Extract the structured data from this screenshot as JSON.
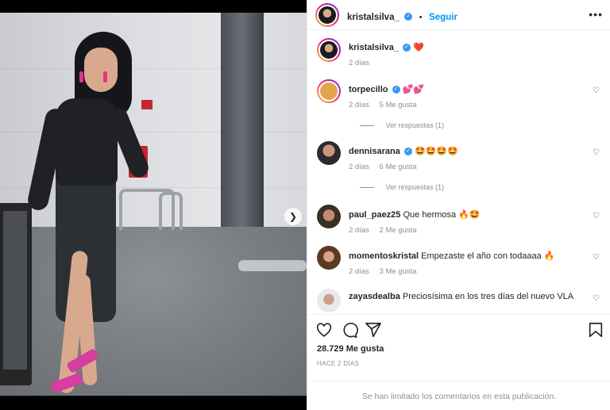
{
  "post": {
    "author": "kristalsilva_",
    "follow_label": "Seguir",
    "more_label": "•••"
  },
  "caption": {
    "username": "kristalsilva_",
    "text": "❤️",
    "time": "2 días"
  },
  "comments": [
    {
      "username": "torpecillo",
      "text": "💕💕",
      "time": "2 días",
      "likes": "5 Me gusta",
      "replies": "Ver respuestas (1)"
    },
    {
      "username": "dennisarana",
      "text": "🤩🤩🤩🤩",
      "time": "2 días",
      "likes": "6 Me gusta",
      "replies": "Ver respuestas (1)"
    },
    {
      "username": "paul_paez25",
      "text": "Que hermosa 🔥🤩",
      "time": "2 días",
      "likes": "2 Me gusta",
      "replies": ""
    },
    {
      "username": "momentoskristal",
      "text": "Empezaste el año con todaaaa 🔥",
      "time": "2 días",
      "likes": "3 Me gusta",
      "replies": ""
    },
    {
      "username": "zayasdealba",
      "text": "Preciosísima en los tres días del nuevo VLA",
      "time": "",
      "likes": "",
      "replies": ""
    }
  ],
  "stats": {
    "likes": "28.729 Me gusta",
    "posted": "HACE 2 DÍAS"
  },
  "footer": {
    "notice": "Se han limitado los comentarios en esta publicación."
  },
  "icons": {
    "heart": "heart-icon",
    "comment": "comment-icon",
    "share": "share-icon",
    "save": "bookmark-icon",
    "verified": "verified-badge-icon",
    "next": "chevron-right-icon"
  },
  "colors": {
    "accent": "#0095f6",
    "verified": "#3897f0",
    "muted": "#8e8e8e"
  },
  "carousel": {
    "total": 2,
    "current": 1
  }
}
